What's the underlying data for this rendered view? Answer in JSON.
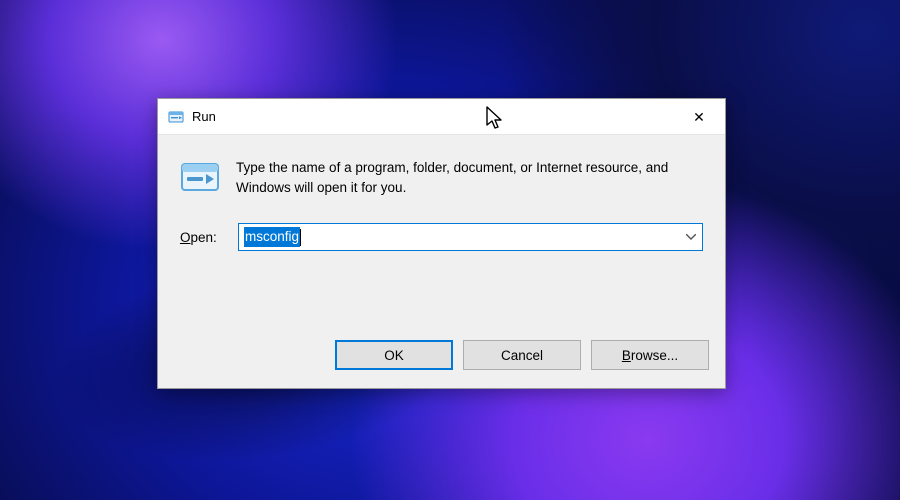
{
  "window": {
    "title": "Run",
    "description": "Type the name of a program, folder, document, or Internet resource, and Windows will open it for you.",
    "open_label_prefix": "O",
    "open_label_rest": "pen:",
    "input_value": "msconfig",
    "buttons": {
      "ok": "OK",
      "cancel": "Cancel",
      "browse_prefix": "B",
      "browse_rest": "rowse..."
    },
    "close_glyph": "✕"
  }
}
